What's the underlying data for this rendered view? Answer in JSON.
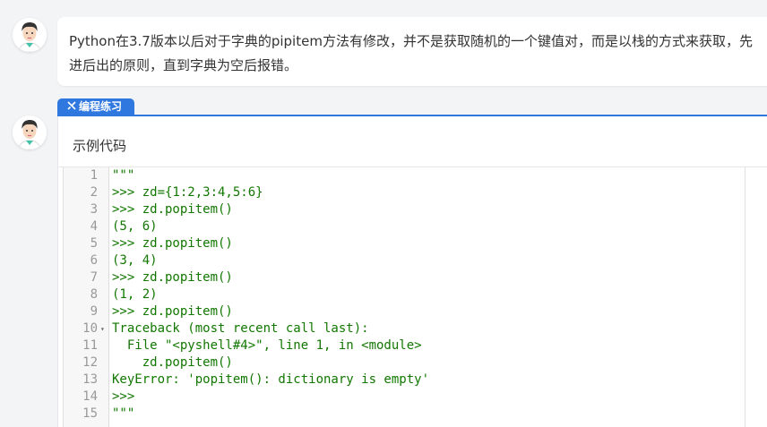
{
  "message": {
    "text": "Python在3.7版本以后对于字典的pipitem方法有修改，并不是获取随机的一个键值对，而是以栈的方式来获取，先进后出的原则，直到字典为空后报错。"
  },
  "tab": {
    "icon": "code-tool-icon",
    "label": "编程练习"
  },
  "card": {
    "title": "示例代码"
  },
  "code": {
    "lines": [
      {
        "n": "1",
        "text": "\"\"\""
      },
      {
        "n": "2",
        "text": ">>> zd={1:2,3:4,5:6}"
      },
      {
        "n": "3",
        "text": ">>> zd.popitem()"
      },
      {
        "n": "4",
        "text": "(5, 6)"
      },
      {
        "n": "5",
        "text": ">>> zd.popitem()"
      },
      {
        "n": "6",
        "text": "(3, 4)"
      },
      {
        "n": "7",
        "text": ">>> zd.popitem()"
      },
      {
        "n": "8",
        "text": "(1, 2)"
      },
      {
        "n": "9",
        "text": ">>> zd.popitem()"
      },
      {
        "n": "10",
        "text": "Traceback (most recent call last):"
      },
      {
        "n": "11",
        "text": "  File \"<pyshell#4>\", line 1, in <module>"
      },
      {
        "n": "12",
        "text": "    zd.popitem()"
      },
      {
        "n": "13",
        "text": "KeyError: 'popitem(): dictionary is empty'"
      },
      {
        "n": "14",
        "text": ">>>"
      },
      {
        "n": "15",
        "text": "\"\"\""
      }
    ],
    "fold_marker": "▾",
    "colors": {
      "code": "#117700",
      "line_number": "#999999"
    }
  },
  "colors": {
    "accent": "#2f78e0",
    "background": "#f3f4f6"
  }
}
